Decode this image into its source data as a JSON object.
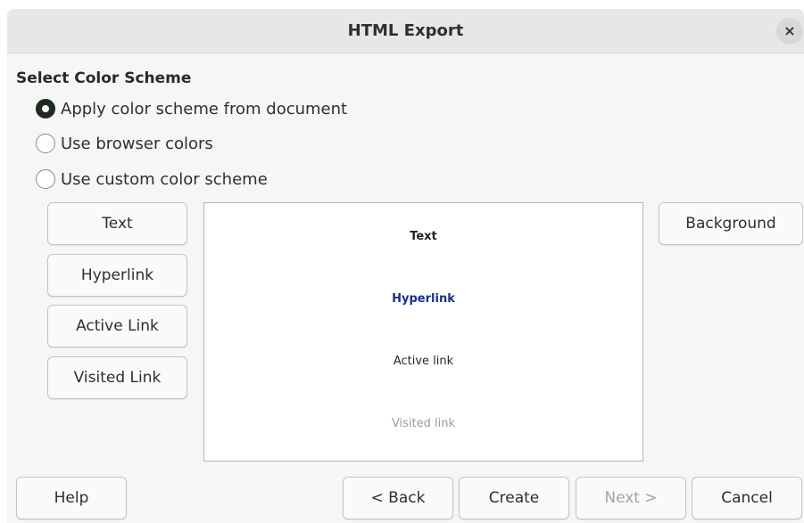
{
  "window": {
    "title": "HTML Export",
    "close_glyph": "×"
  },
  "section": {
    "title": "Select Color Scheme"
  },
  "color_scheme_options": [
    {
      "label": "Apply color scheme from document",
      "checked": true
    },
    {
      "label": "Use browser colors",
      "checked": false
    },
    {
      "label": "Use custom color scheme",
      "checked": false
    }
  ],
  "color_buttons": {
    "text": "Text",
    "hyperlink": "Hyperlink",
    "active_link": "Active Link",
    "visited_link": "Visited Link",
    "background": "Background"
  },
  "preview": {
    "text": "Text",
    "hyperlink": "Hyperlink",
    "active_link": "Active link",
    "visited_link": "Visited link",
    "hyperlink_color": "#1a2f8a",
    "visited_color": "#9b9b9b"
  },
  "footer": {
    "help": "Help",
    "back": "< Back",
    "create": "Create",
    "next": "Next >",
    "next_disabled": true,
    "cancel": "Cancel"
  }
}
